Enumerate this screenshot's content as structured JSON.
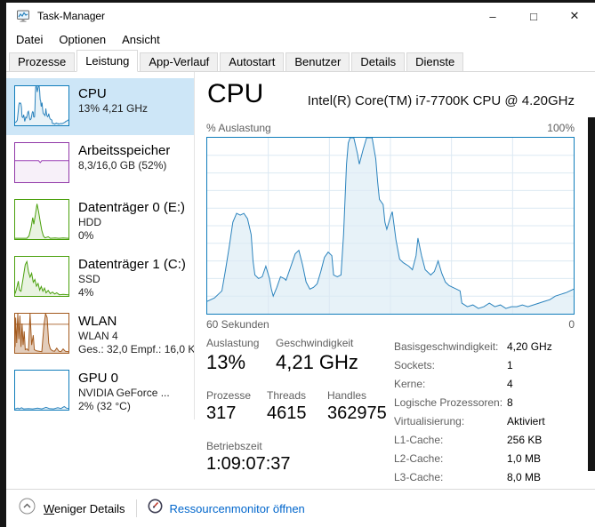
{
  "window": {
    "title": "Task-Manager",
    "controls": {
      "minimize": "–",
      "maximize": "□",
      "close": "✕"
    }
  },
  "menu": {
    "items": [
      "Datei",
      "Optionen",
      "Ansicht"
    ]
  },
  "tabs": {
    "items": [
      "Prozesse",
      "Leistung",
      "App-Verlauf",
      "Autostart",
      "Benutzer",
      "Details",
      "Dienste"
    ],
    "selected": "Leistung"
  },
  "sidebar": {
    "items": [
      {
        "id": "cpu",
        "title": "CPU",
        "line2": "13% 4,21 GHz",
        "line3": "",
        "color": "#117dbb",
        "selected": true
      },
      {
        "id": "memory",
        "title": "Arbeitsspeicher",
        "line2": "8,3/16,0 GB (52%)",
        "line3": "",
        "color": "#9138a8",
        "selected": false
      },
      {
        "id": "disk0",
        "title": "Datenträger 0 (E:)",
        "line2": "HDD",
        "line3": "0%",
        "color": "#4aa00c",
        "selected": false
      },
      {
        "id": "disk1",
        "title": "Datenträger 1 (C:)",
        "line2": "SSD",
        "line3": "4%",
        "color": "#4aa00c",
        "selected": false
      },
      {
        "id": "wlan",
        "title": "WLAN",
        "line2": "WLAN 4",
        "line3": "Ges.: 32,0 Empf.: 16,0 K",
        "color": "#a35a1e",
        "selected": false
      },
      {
        "id": "gpu",
        "title": "GPU 0",
        "line2": "NVIDIA GeForce ...",
        "line3": "2% (32 °C)",
        "color": "#117dbb",
        "selected": false
      }
    ]
  },
  "main": {
    "title": "CPU",
    "subtitle": "Intel(R) Core(TM) i7-7700K CPU @ 4.20GHz",
    "chart_top_left": "% Auslastung",
    "chart_top_right": "100%",
    "chart_bottom_left": "60 Sekunden",
    "chart_bottom_right": "0",
    "stats": {
      "auslastung_label": "Auslastung",
      "auslastung_value": "13%",
      "geschwindigkeit_label": "Geschwindigkeit",
      "geschwindigkeit_value": "4,21 GHz",
      "prozesse_label": "Prozesse",
      "prozesse_value": "317",
      "threads_label": "Threads",
      "threads_value": "4615",
      "handles_label": "Handles",
      "handles_value": "362975",
      "betriebszeit_label": "Betriebszeit",
      "betriebszeit_value": "1:09:07:37"
    },
    "details": [
      {
        "label": "Basisgeschwindigkeit:",
        "value": "4,20 GHz"
      },
      {
        "label": "Sockets:",
        "value": "1"
      },
      {
        "label": "Kerne:",
        "value": "4"
      },
      {
        "label": "Logische Prozessoren:",
        "value": "8"
      },
      {
        "label": "Virtualisierung:",
        "value": "Aktiviert"
      },
      {
        "label": "L1-Cache:",
        "value": "256 KB"
      },
      {
        "label": "L2-Cache:",
        "value": "1,0 MB"
      },
      {
        "label": "L3-Cache:",
        "value": "8,0 MB"
      }
    ]
  },
  "footer": {
    "collapse_label": "Weniger Details",
    "resmon_label": "Ressourcenmonitor öffnen"
  },
  "colors": {
    "accent": "#117dbb",
    "selection": "#cde6f7",
    "link": "#0066cc",
    "grid": "#dce9f3",
    "label_gray": "#5f5f5f",
    "disk_green": "#4aa00c",
    "memory_purple": "#9138a8",
    "wlan_brown": "#a35a1e"
  },
  "chart_data": {
    "cpu": {
      "type": "area",
      "title": "CPU % Auslastung, 60 Sekunden Verlauf",
      "ylabel": "% Auslastung",
      "xlabel_left": "60 Sekunden",
      "xlabel_right": "0",
      "ylim": [
        0,
        100
      ],
      "grid": true,
      "grid_color": "#dce9f3",
      "stroke": "#2b83bd",
      "fill": "rgba(17,125,187,0.10)",
      "points": [
        [
          0,
          7
        ],
        [
          0.02,
          9
        ],
        [
          0.04,
          13
        ],
        [
          0.05,
          25
        ],
        [
          0.06,
          38
        ],
        [
          0.07,
          52
        ],
        [
          0.08,
          57
        ],
        [
          0.09,
          56
        ],
        [
          0.1,
          57
        ],
        [
          0.11,
          54
        ],
        [
          0.12,
          45
        ],
        [
          0.125,
          30
        ],
        [
          0.13,
          22
        ],
        [
          0.14,
          20
        ],
        [
          0.15,
          21
        ],
        [
          0.16,
          27
        ],
        [
          0.17,
          20
        ],
        [
          0.175,
          14
        ],
        [
          0.18,
          10
        ],
        [
          0.19,
          15
        ],
        [
          0.2,
          21
        ],
        [
          0.21,
          20
        ],
        [
          0.215,
          19
        ],
        [
          0.23,
          28
        ],
        [
          0.24,
          34
        ],
        [
          0.25,
          36
        ],
        [
          0.26,
          28
        ],
        [
          0.27,
          18
        ],
        [
          0.28,
          14
        ],
        [
          0.29,
          15
        ],
        [
          0.3,
          17
        ],
        [
          0.31,
          24
        ],
        [
          0.32,
          32
        ],
        [
          0.33,
          35
        ],
        [
          0.34,
          33
        ],
        [
          0.345,
          22
        ],
        [
          0.355,
          21
        ],
        [
          0.365,
          22
        ],
        [
          0.372,
          45
        ],
        [
          0.38,
          85
        ],
        [
          0.385,
          97
        ],
        [
          0.39,
          100
        ],
        [
          0.4,
          100
        ],
        [
          0.41,
          91
        ],
        [
          0.415,
          85
        ],
        [
          0.425,
          93
        ],
        [
          0.435,
          100
        ],
        [
          0.45,
          100
        ],
        [
          0.46,
          88
        ],
        [
          0.465,
          75
        ],
        [
          0.47,
          65
        ],
        [
          0.48,
          62
        ],
        [
          0.485,
          52
        ],
        [
          0.49,
          48
        ],
        [
          0.5,
          55
        ],
        [
          0.505,
          58
        ],
        [
          0.515,
          42
        ],
        [
          0.525,
          31
        ],
        [
          0.535,
          29
        ],
        [
          0.55,
          27
        ],
        [
          0.56,
          25
        ],
        [
          0.57,
          33
        ],
        [
          0.575,
          43
        ],
        [
          0.585,
          33
        ],
        [
          0.595,
          25
        ],
        [
          0.61,
          22
        ],
        [
          0.62,
          24
        ],
        [
          0.63,
          30
        ],
        [
          0.64,
          23
        ],
        [
          0.65,
          18
        ],
        [
          0.66,
          16
        ],
        [
          0.67,
          15
        ],
        [
          0.68,
          14
        ],
        [
          0.69,
          13
        ],
        [
          0.695,
          6
        ],
        [
          0.71,
          4
        ],
        [
          0.725,
          5
        ],
        [
          0.74,
          3
        ],
        [
          0.755,
          4
        ],
        [
          0.77,
          6
        ],
        [
          0.785,
          4
        ],
        [
          0.8,
          5
        ],
        [
          0.815,
          3
        ],
        [
          0.83,
          4
        ],
        [
          0.845,
          4
        ],
        [
          0.86,
          5
        ],
        [
          0.875,
          4
        ],
        [
          0.89,
          5
        ],
        [
          0.905,
          6
        ],
        [
          0.92,
          7
        ],
        [
          0.935,
          8
        ],
        [
          0.95,
          10
        ],
        [
          0.965,
          11
        ],
        [
          0.98,
          12
        ],
        [
          1,
          14
        ]
      ]
    },
    "memory": {
      "type": "area",
      "title": "Arbeitsspeicher Zusammensetzung (52% belegt)",
      "stroke": "#9a3fb5",
      "fill": "rgba(154,63,181,0.08)",
      "points": [
        [
          0,
          55
        ],
        [
          0.4,
          55
        ],
        [
          0.44,
          55
        ],
        [
          0.47,
          50
        ],
        [
          0.5,
          55
        ],
        [
          1,
          55
        ]
      ]
    },
    "disk0": {
      "type": "area",
      "title": "Datenträger 0 Aktivität (0%)",
      "stroke": "#4aa00c",
      "fill": "rgba(74,160,12,0.12)",
      "points": [
        [
          0,
          2
        ],
        [
          0.22,
          2
        ],
        [
          0.26,
          8
        ],
        [
          0.3,
          30
        ],
        [
          0.33,
          55
        ],
        [
          0.35,
          38
        ],
        [
          0.38,
          62
        ],
        [
          0.41,
          90
        ],
        [
          0.44,
          70
        ],
        [
          0.47,
          45
        ],
        [
          0.5,
          22
        ],
        [
          0.53,
          8
        ],
        [
          0.56,
          3
        ],
        [
          0.62,
          6
        ],
        [
          0.66,
          2
        ],
        [
          0.75,
          3
        ],
        [
          0.82,
          2
        ],
        [
          0.9,
          3
        ],
        [
          1,
          2
        ]
      ]
    },
    "disk1": {
      "type": "area",
      "title": "Datenträger 1 Aktivität (4%)",
      "stroke": "#4aa00c",
      "fill": "rgba(74,160,12,0.12)",
      "points": [
        [
          0,
          6
        ],
        [
          0.03,
          20
        ],
        [
          0.06,
          38
        ],
        [
          0.08,
          15
        ],
        [
          0.11,
          12
        ],
        [
          0.15,
          45
        ],
        [
          0.19,
          80
        ],
        [
          0.22,
          88
        ],
        [
          0.25,
          62
        ],
        [
          0.28,
          48
        ],
        [
          0.31,
          58
        ],
        [
          0.34,
          35
        ],
        [
          0.37,
          42
        ],
        [
          0.4,
          25
        ],
        [
          0.43,
          32
        ],
        [
          0.46,
          15
        ],
        [
          0.49,
          24
        ],
        [
          0.52,
          12
        ],
        [
          0.55,
          20
        ],
        [
          0.58,
          8
        ],
        [
          0.62,
          14
        ],
        [
          0.66,
          6
        ],
        [
          0.7,
          10
        ],
        [
          0.74,
          5
        ],
        [
          0.78,
          8
        ],
        [
          0.83,
          3
        ],
        [
          0.9,
          4
        ],
        [
          1,
          3
        ]
      ]
    },
    "wlan": {
      "type": "area",
      "title": "WLAN Durchsatz (Ges.: 32,0 / Empf.: 16,0 K)",
      "stroke": "#a35a1e",
      "fill": "rgba(163,90,30,0.30)",
      "hline_pct": 73,
      "points": [
        [
          0,
          15
        ],
        [
          0.01,
          90
        ],
        [
          0.03,
          25
        ],
        [
          0.05,
          100
        ],
        [
          0.07,
          35
        ],
        [
          0.09,
          95
        ],
        [
          0.11,
          15
        ],
        [
          0.13,
          75
        ],
        [
          0.15,
          20
        ],
        [
          0.17,
          55
        ],
        [
          0.19,
          8
        ],
        [
          0.22,
          10
        ],
        [
          0.25,
          6
        ],
        [
          0.28,
          100
        ],
        [
          0.31,
          20
        ],
        [
          0.34,
          45
        ],
        [
          0.36,
          8
        ],
        [
          0.4,
          5
        ],
        [
          0.45,
          4
        ],
        [
          0.5,
          3
        ],
        [
          0.54,
          70
        ],
        [
          0.57,
          100
        ],
        [
          0.6,
          90
        ],
        [
          0.63,
          25
        ],
        [
          0.66,
          10
        ],
        [
          0.7,
          5
        ],
        [
          0.74,
          4
        ],
        [
          0.78,
          12
        ],
        [
          0.82,
          4
        ],
        [
          0.86,
          3
        ],
        [
          0.9,
          10
        ],
        [
          0.94,
          4
        ],
        [
          1,
          3
        ]
      ]
    },
    "gpu": {
      "type": "area",
      "title": "GPU 0 Auslastung (2%)",
      "stroke": "#2b83bd",
      "fill": "rgba(17,125,187,0.10)",
      "points": [
        [
          0,
          2
        ],
        [
          0.05,
          4
        ],
        [
          0.08,
          2
        ],
        [
          0.12,
          5
        ],
        [
          0.16,
          2
        ],
        [
          0.25,
          3
        ],
        [
          0.33,
          2
        ],
        [
          0.42,
          4
        ],
        [
          0.5,
          2
        ],
        [
          0.58,
          6
        ],
        [
          0.64,
          3
        ],
        [
          0.72,
          2
        ],
        [
          0.8,
          5
        ],
        [
          0.86,
          3
        ],
        [
          0.92,
          8
        ],
        [
          0.96,
          4
        ],
        [
          1,
          3
        ]
      ]
    }
  }
}
